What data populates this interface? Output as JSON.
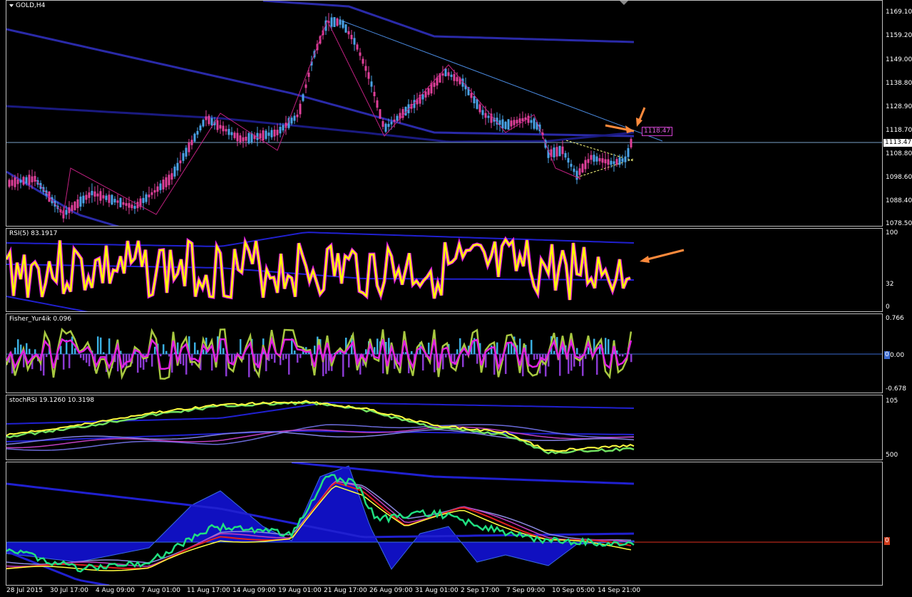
{
  "symbol_title": "GOLD,H4",
  "price_scale": [
    "1169.10",
    "1159.20",
    "1149.00",
    "1138.80",
    "1128.90",
    "1118.70",
    "1108.80",
    "1098.60",
    "1088.40",
    "1078.50"
  ],
  "current_price": "1113.47",
  "trendline_price_tag": "1118.47",
  "rsi": {
    "label": "RSI(5) 83.1917",
    "scale": [
      "100",
      "32",
      "0"
    ]
  },
  "fisher": {
    "label": "Fisher_Yur4ik 0.096",
    "scale": [
      "0.766",
      "0.00",
      "-0.678"
    ],
    "marker": "0"
  },
  "stochrsi": {
    "label": "stochRSI 19.1260 10.3198",
    "scale": [
      "105",
      "500"
    ]
  },
  "bottom_pane": {
    "marker": "0"
  },
  "time_axis": [
    "28 Jul 2015",
    "30 Jul 17:00",
    "4 Aug 09:00",
    "7 Aug 01:00",
    "11 Aug 17:00",
    "14 Aug 09:00",
    "19 Aug 01:00",
    "21 Aug 17:00",
    "26 Aug 09:00",
    "31 Aug 01:00",
    "2 Sep 17:00",
    "7 Sep 09:00",
    "10 Sep 05:00",
    "14 Sep 21:00"
  ],
  "colors": {
    "bull": "#4aa3e8",
    "bear": "#e0409a",
    "band": "#2a2aa8",
    "rsi": "#ffff00",
    "rsi_outline": "#e020e0",
    "stoch": "#ffff40",
    "green": "#20e080",
    "hist_blue": "#1010c0",
    "fisher_hist": "#3aaee0",
    "fisher_neg": "#8a3ad0",
    "arrow": "#ff8a3c"
  }
}
